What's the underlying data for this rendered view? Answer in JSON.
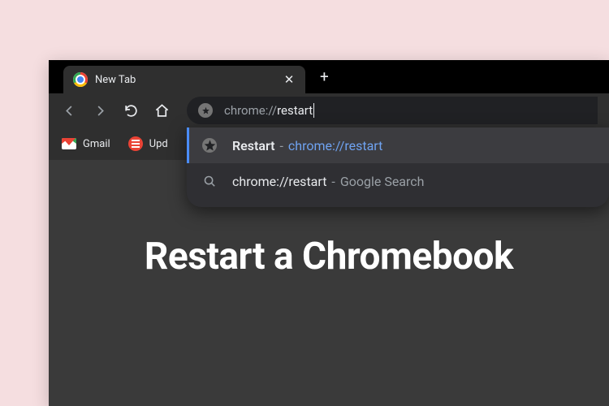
{
  "tab": {
    "title": "New Tab"
  },
  "omnibox": {
    "prefix": "chrome://",
    "rest": "restart"
  },
  "bookmarks": {
    "gmail": "Gmail",
    "updates": "Upd"
  },
  "suggestions": [
    {
      "title": "Restart",
      "dash": "-",
      "url": "chrome://restart"
    },
    {
      "query": "chrome://restart",
      "dash": "-",
      "search": "Google Search"
    }
  ],
  "page": {
    "headline": "Restart a Chromebook"
  }
}
